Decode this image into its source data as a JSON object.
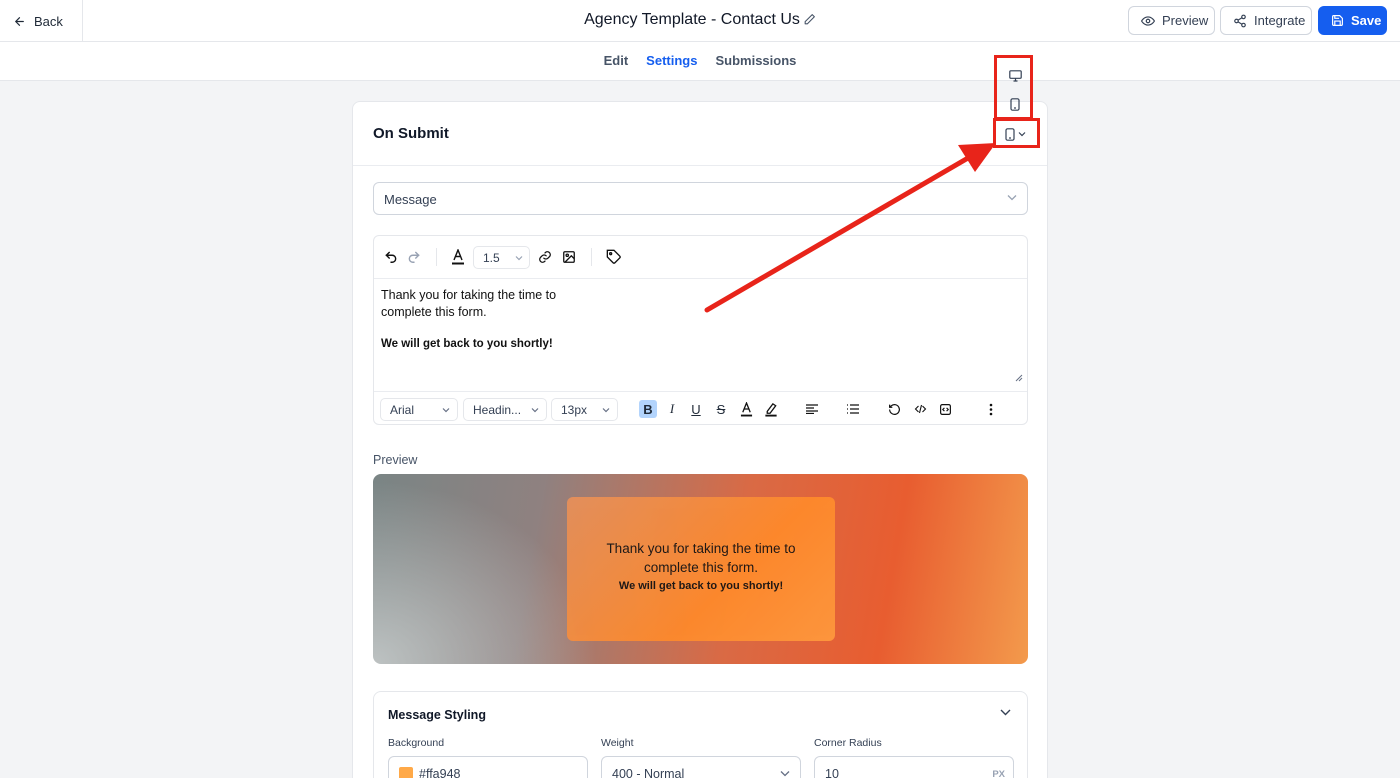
{
  "header": {
    "back_label": "Back",
    "title": "Agency Template - Contact Us",
    "preview_label": "Preview",
    "integrate_label": "Integrate",
    "save_label": "Save"
  },
  "tabs": [
    {
      "label": "Edit",
      "active": false
    },
    {
      "label": "Settings",
      "active": true
    },
    {
      "label": "Submissions",
      "active": false
    }
  ],
  "card": {
    "title": "On Submit",
    "action_select": "Message"
  },
  "editor": {
    "line_height": "1.5",
    "body_line1": "Thank you for taking the time to",
    "body_line2": "complete this form.",
    "body_bold": "We will get back to you shortly!",
    "font_family": "Arial",
    "block_type": "Headin...",
    "font_size": "13px"
  },
  "preview": {
    "label": "Preview",
    "line1": "Thank you for taking the time to",
    "line2": "complete this form.",
    "bold": "We will get back to you shortly!"
  },
  "styling": {
    "title": "Message Styling",
    "background_label": "Background",
    "background_value": "#ffa948",
    "weight_label": "Weight",
    "weight_value": "400 - Normal",
    "radius_label": "Corner Radius",
    "radius_value": "10",
    "radius_unit": "PX"
  },
  "colors": {
    "accent": "#155eef",
    "annotation": "#e8241a",
    "message_bg": "#ffa948"
  }
}
